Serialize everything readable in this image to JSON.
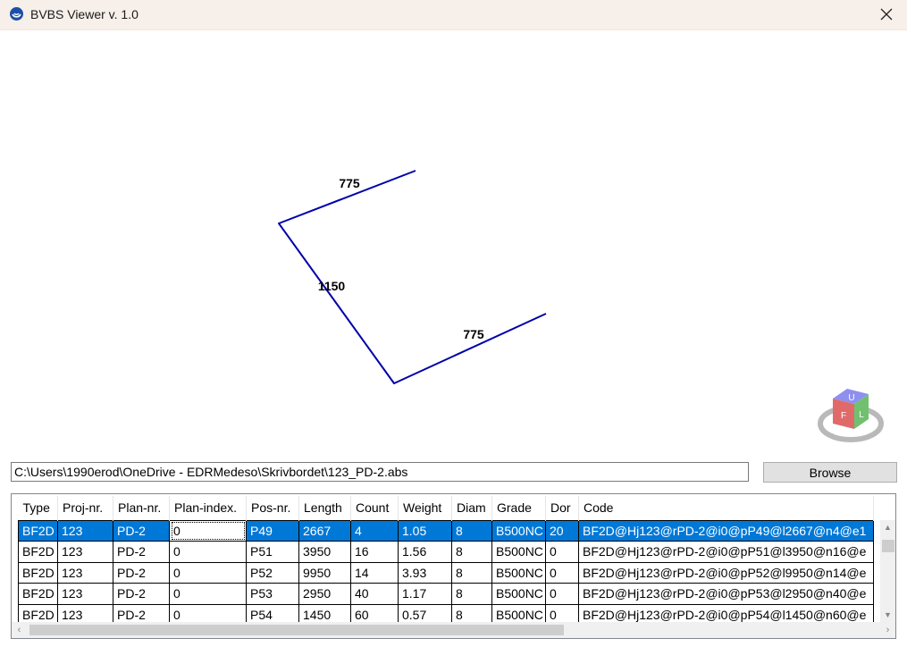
{
  "window": {
    "title": "BVBS Viewer v. 1.0",
    "icon": "app-logo-icon",
    "close_icon": "close-icon"
  },
  "viewport": {
    "dimension_labels": [
      "775",
      "1150",
      "775"
    ],
    "line_color": "#0000aa",
    "view_cube": {
      "faces": [
        "U",
        "F",
        "L"
      ]
    }
  },
  "file": {
    "path": "C:\\Users\\1990erod\\OneDrive - EDRMedeso\\Skrivbordet\\123_PD-2.abs",
    "browse_label": "Browse"
  },
  "grid": {
    "columns": [
      "Type",
      "Proj-nr.",
      "Plan-nr.",
      "Plan-index.",
      "Pos-nr.",
      "Length",
      "Count",
      "Weight",
      "Diam",
      "Grade",
      "Dor",
      "Code"
    ],
    "rows": [
      [
        "BF2D",
        "123",
        "PD-2",
        "0",
        "P49",
        "2667",
        "4",
        "1.05",
        "8",
        "B500NC",
        "20",
        "BF2D@Hj123@rPD-2@i0@pP49@l2667@n4@e1"
      ],
      [
        "BF2D",
        "123",
        "PD-2",
        "0",
        "P51",
        "3950",
        "16",
        "1.56",
        "8",
        "B500NC",
        "0",
        "BF2D@Hj123@rPD-2@i0@pP51@l3950@n16@e"
      ],
      [
        "BF2D",
        "123",
        "PD-2",
        "0",
        "P52",
        "9950",
        "14",
        "3.93",
        "8",
        "B500NC",
        "0",
        "BF2D@Hj123@rPD-2@i0@pP52@l9950@n14@e"
      ],
      [
        "BF2D",
        "123",
        "PD-2",
        "0",
        "P53",
        "2950",
        "40",
        "1.17",
        "8",
        "B500NC",
        "0",
        "BF2D@Hj123@rPD-2@i0@pP53@l2950@n40@e"
      ],
      [
        "BF2D",
        "123",
        "PD-2",
        "0",
        "P54",
        "1450",
        "60",
        "0.57",
        "8",
        "B500NC",
        "0",
        "BF2D@Hj123@rPD-2@i0@pP54@l1450@n60@e"
      ]
    ],
    "selected_row": 0,
    "accent": "#0078d7"
  }
}
